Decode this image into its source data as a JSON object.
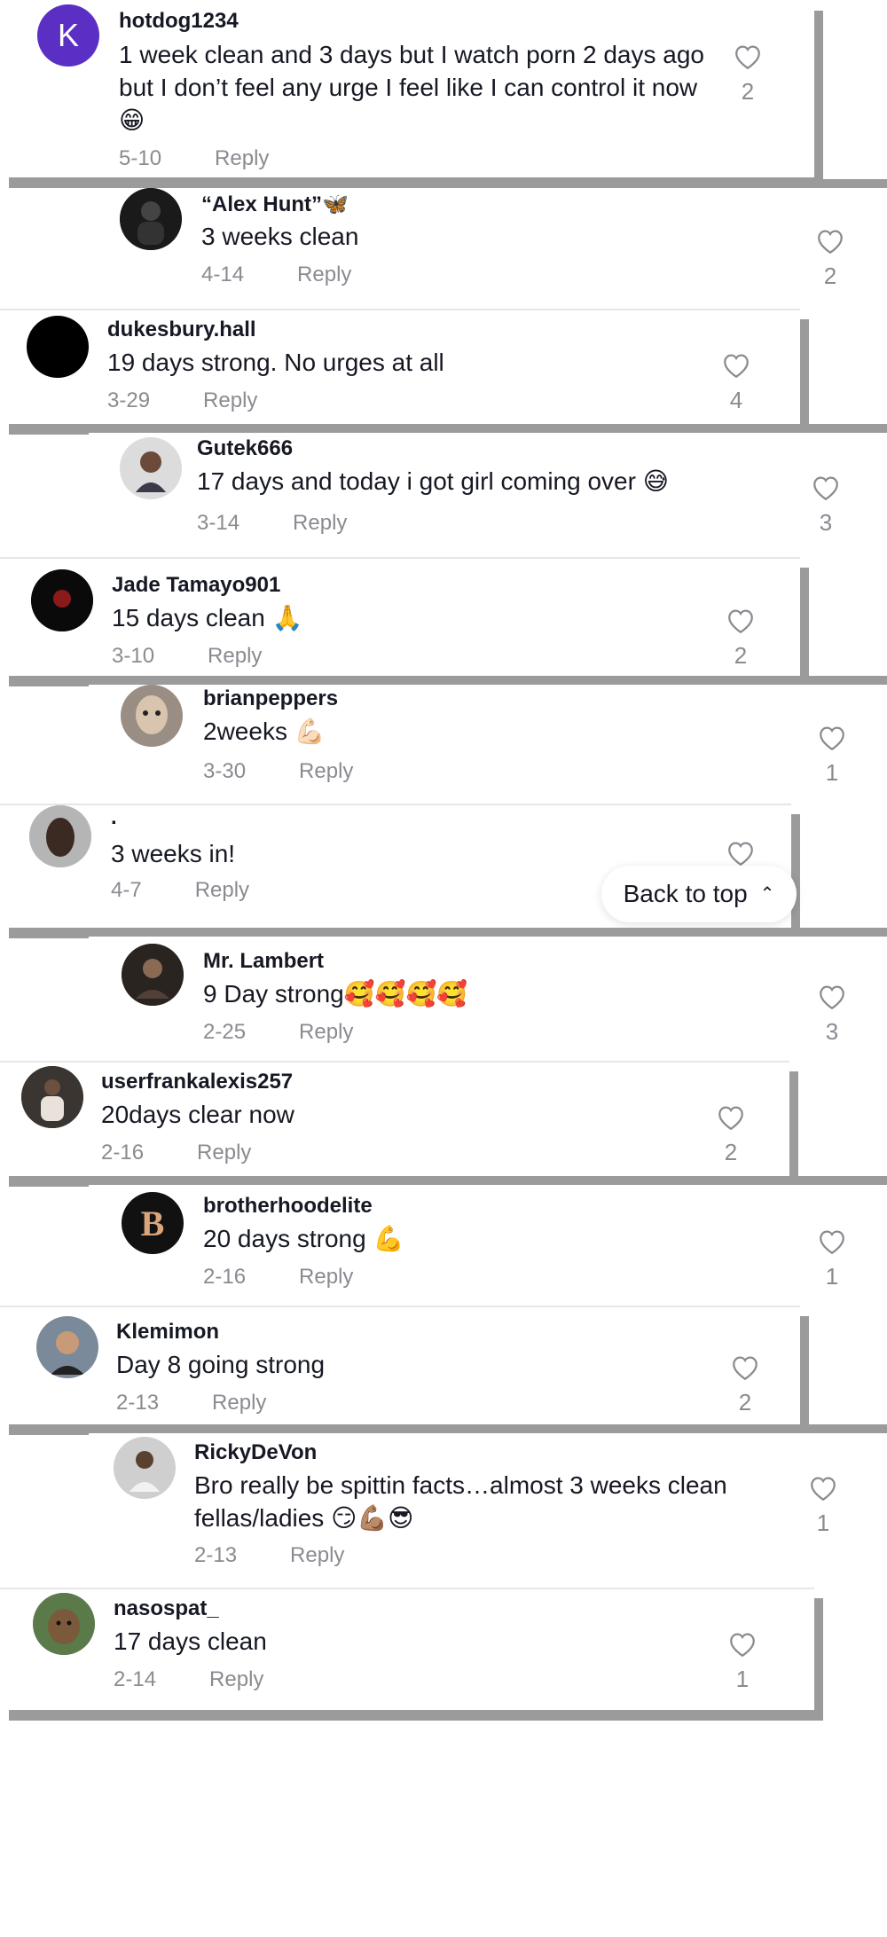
{
  "back_to_top": {
    "label": "Back to top",
    "icon": "double-chevron-up-icon"
  },
  "reply_label": "Reply",
  "comments": [
    {
      "username": "hotdog1234",
      "text": "1 week clean and 3 days but I watch porn 2 days ago but I don’t feel any urge I feel like I can control it now 😁",
      "date": "5-10",
      "likes": "2",
      "avatar_letter": "K",
      "avatar_color": "#5b2fc4"
    },
    {
      "username": "“Alex Hunt”🦋",
      "text": "3 weeks clean",
      "date": "4-14",
      "likes": "2"
    },
    {
      "username": "dukesbury.hall",
      "text": "19 days strong. No urges at all",
      "date": "3-29",
      "likes": "4",
      "avatar_color": "#000000"
    },
    {
      "username": "Gutek666",
      "text": "17 days and today i got girl coming over 😅",
      "date": "3-14",
      "likes": "3"
    },
    {
      "username": "Jade Tamayo901",
      "text": "15 days clean 🙏",
      "date": "3-10",
      "likes": "2"
    },
    {
      "username": "brianpeppers",
      "text": "2weeks 💪🏻",
      "date": "3-30",
      "likes": "1"
    },
    {
      "username": ".",
      "text": "3 weeks in!",
      "date": "4-7",
      "likes": ""
    },
    {
      "username": "Mr. Lambert",
      "text": "9 Day strong🥰🥰🥰🥰",
      "date": "2-25",
      "likes": "3"
    },
    {
      "username": "userfrankalexis257",
      "text": "20days clear now",
      "date": "2-16",
      "likes": "2"
    },
    {
      "username": "brotherhoodelite",
      "text": "20 days strong 💪",
      "date": "2-16",
      "likes": "1",
      "avatar_letter": "B"
    },
    {
      "username": "Klemimon",
      "text": "Day 8 going strong",
      "date": "2-13",
      "likes": "2"
    },
    {
      "username": "RickyDeVon",
      "text": "Bro really be spittin facts…almost 3 weeks clean fellas/ladies 😏💪🏽😎",
      "date": "2-13",
      "likes": "1"
    },
    {
      "username": "nasospat_",
      "text": "17 days clean",
      "date": "2-14",
      "likes": "1"
    }
  ]
}
